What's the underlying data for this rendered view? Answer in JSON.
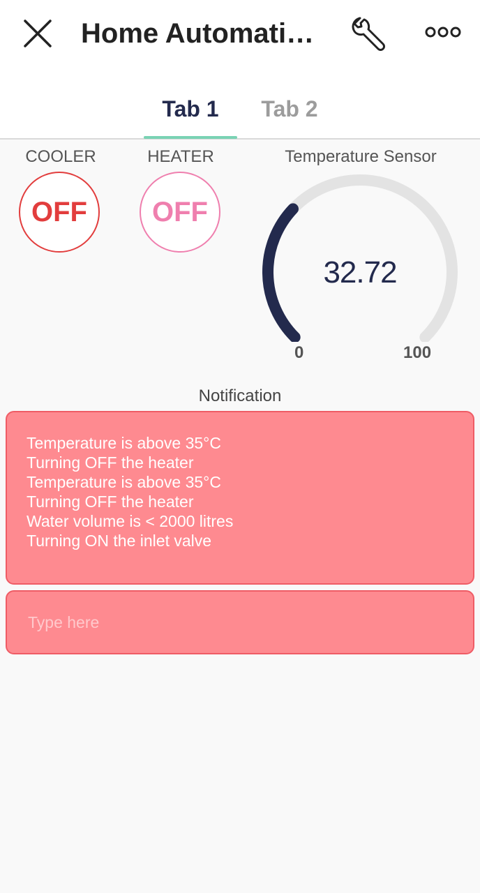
{
  "header": {
    "title": "Home Automati…",
    "icons": {
      "close": "close-icon",
      "settings": "wrench-icon",
      "more": "more-icon"
    }
  },
  "tabs": [
    {
      "label": "Tab 1",
      "active": true
    },
    {
      "label": "Tab 2",
      "active": false
    }
  ],
  "widgets": {
    "cooler": {
      "label": "COOLER",
      "state": "OFF",
      "color": "#e23d3d"
    },
    "heater": {
      "label": "HEATER",
      "state": "OFF",
      "color": "#ef7fae"
    },
    "gauge": {
      "label": "Temperature Sensor",
      "value": "32.72",
      "numeric_value": 32.72,
      "min": "0",
      "max": "100",
      "color": "#232a4d",
      "track_color": "#e3e3e3"
    }
  },
  "notification": {
    "title": "Notification",
    "lines": [
      "Temperature is above 35°C",
      "Turning OFF the heater",
      "Temperature is above 35°C",
      "Turning OFF the heater",
      "Water volume is < 2000 litres",
      "Turning ON the inlet valve"
    ],
    "input_placeholder": "Type here",
    "input_value": "",
    "color": "#fe8a90"
  },
  "colors": {
    "accent": "#7ad3b4",
    "primary": "#232a4d",
    "background": "#f9f9f9"
  }
}
